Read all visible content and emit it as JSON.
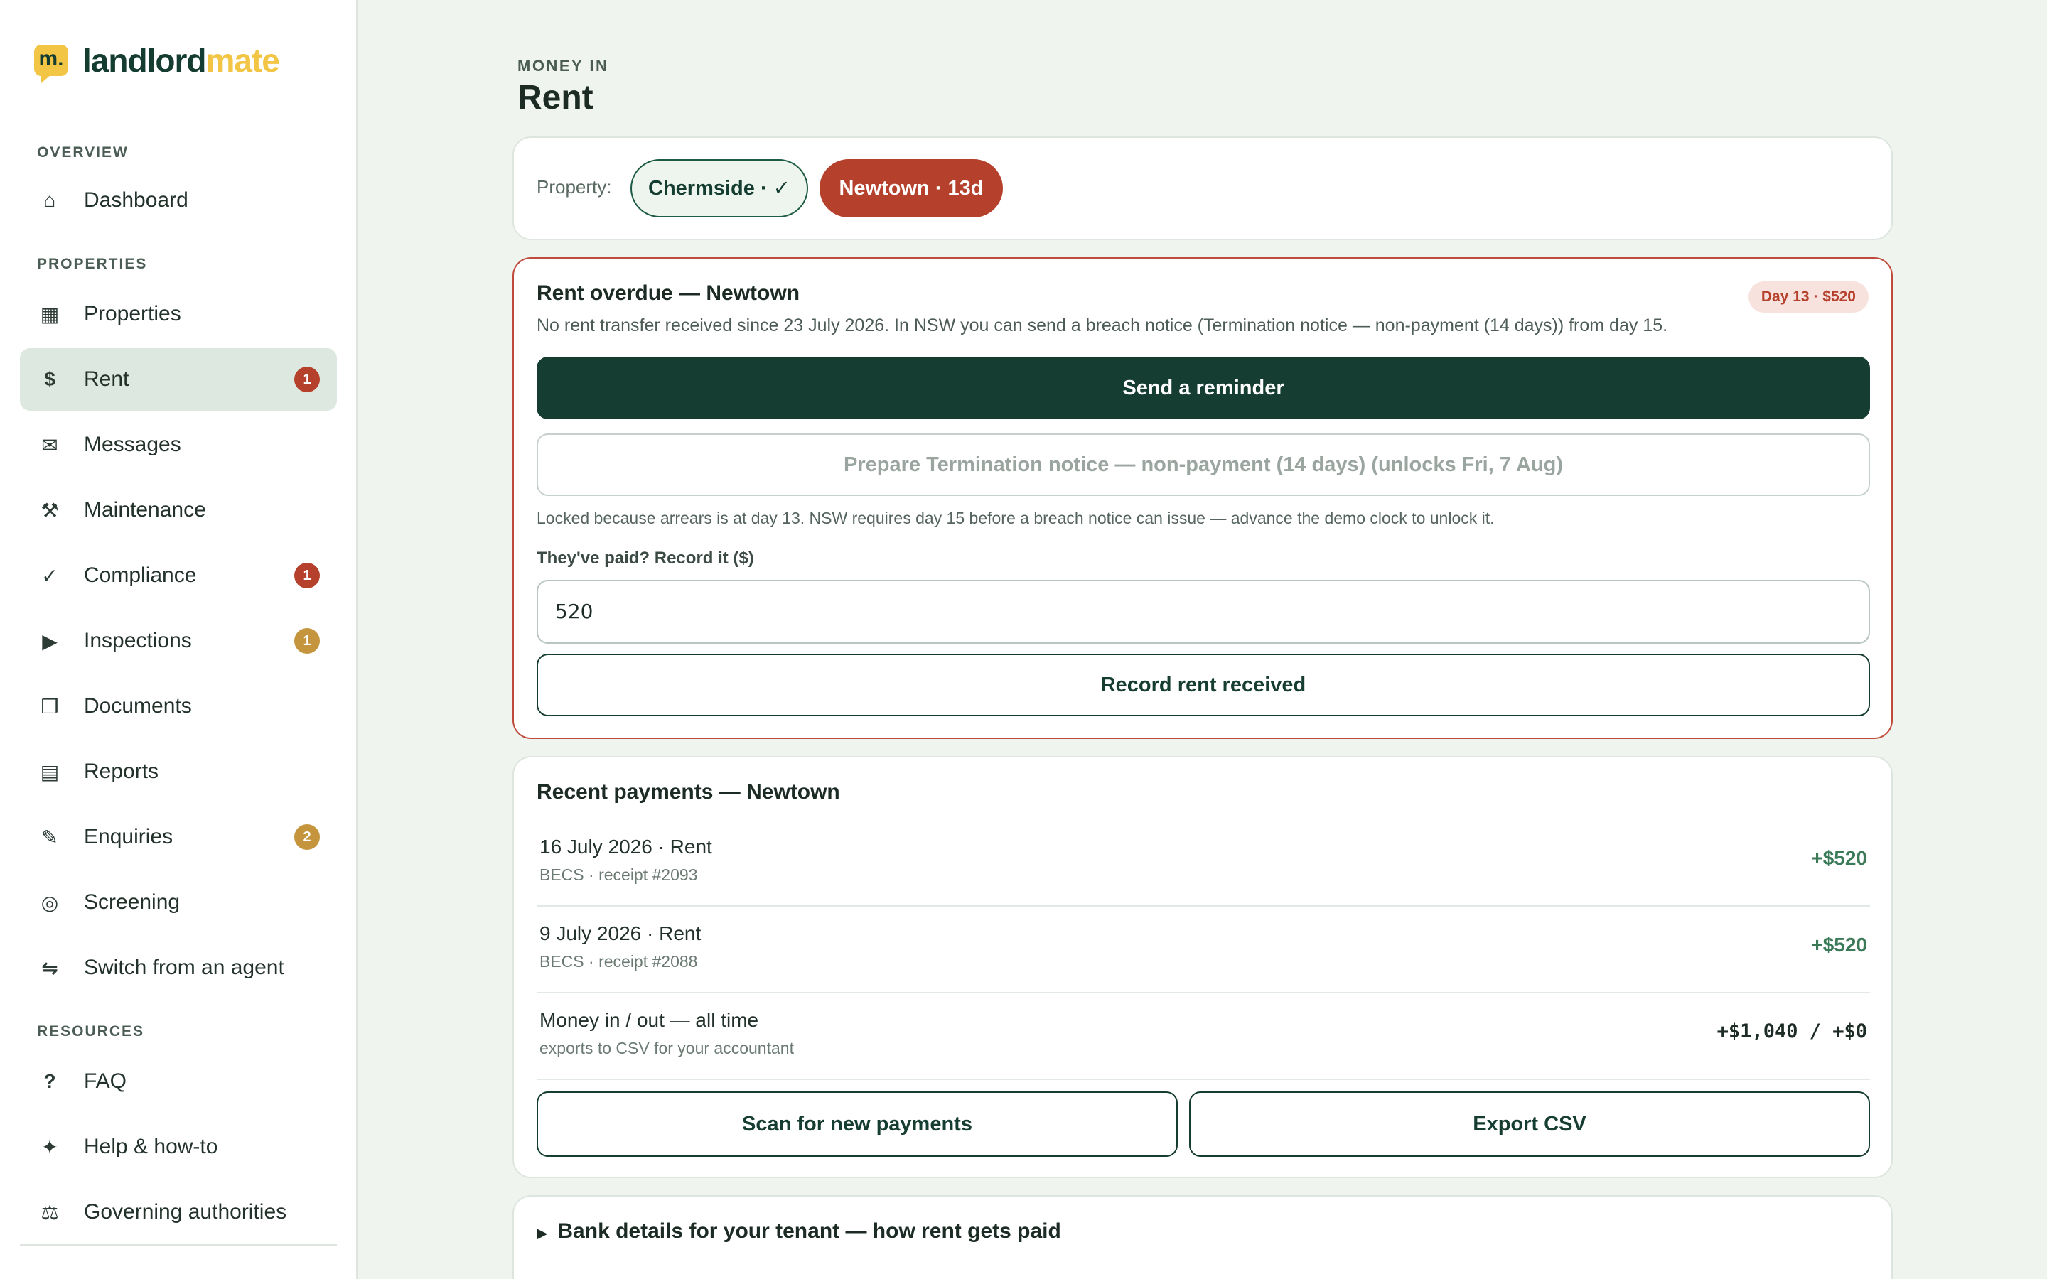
{
  "brand": {
    "mark": "m.",
    "name_part1": "landlord",
    "name_part2": "mate"
  },
  "sidebar": {
    "sections": {
      "overview": "OVERVIEW",
      "properties": "PROPERTIES",
      "resources": "RESOURCES"
    },
    "items": [
      {
        "label": "Dashboard",
        "icon": "home-icon",
        "glyph": "⌂"
      },
      {
        "label": "Properties",
        "icon": "building-icon",
        "glyph": "▦"
      },
      {
        "label": "Rent",
        "icon": "dollar-icon",
        "glyph": "$",
        "badge": "1",
        "active": true
      },
      {
        "label": "Messages",
        "icon": "mail-icon",
        "glyph": "✉"
      },
      {
        "label": "Maintenance",
        "icon": "tools-icon",
        "glyph": "⚒"
      },
      {
        "label": "Compliance",
        "icon": "check-icon",
        "glyph": "✓",
        "badge": "1"
      },
      {
        "label": "Inspections",
        "icon": "play-icon",
        "glyph": "▶",
        "badge": "1"
      },
      {
        "label": "Documents",
        "icon": "document-icon",
        "glyph": "❐"
      },
      {
        "label": "Reports",
        "icon": "report-icon",
        "glyph": "▤"
      },
      {
        "label": "Enquiries",
        "icon": "pencil-icon",
        "glyph": "✎",
        "badge": "2"
      },
      {
        "label": "Screening",
        "icon": "target-icon",
        "glyph": "◎"
      },
      {
        "label": "Switch from an agent",
        "icon": "switch-icon",
        "glyph": "⇋"
      },
      {
        "label": "FAQ",
        "icon": "question-icon",
        "glyph": "?"
      },
      {
        "label": "Help & how-to",
        "icon": "sparkle-icon",
        "glyph": "✦"
      },
      {
        "label": "Governing authorities",
        "icon": "scales-icon",
        "glyph": "⚖"
      }
    ]
  },
  "header": {
    "eyebrow": "MONEY IN",
    "title": "Rent"
  },
  "property_selector": {
    "label": "Property:",
    "chips": [
      {
        "label": "Chermside · ✓",
        "status": "ok"
      },
      {
        "label": "Newtown · 13d",
        "status": "overdue"
      }
    ]
  },
  "alert": {
    "title": "Rent overdue — Newtown",
    "badge": "Day 13 · $520",
    "description": "No rent transfer received since 23 July 2026. In NSW you can send a breach notice (Termination notice — non-payment (14 days)) from day 15.",
    "primary_button": "Send a reminder",
    "disabled_button": "Prepare Termination notice — non-payment (14 days) (unlocks Fri, 7 Aug)",
    "lock_note": "Locked because arrears is at day 13. NSW requires day 15 before a breach notice can issue — advance the demo clock to unlock it.",
    "field_label": "They've paid? Record it ($)",
    "field_value": "520",
    "record_button": "Record rent received"
  },
  "payments": {
    "title": "Recent payments — Newtown",
    "rows": [
      {
        "main": "16 July 2026 · Rent",
        "sub": "BECS · receipt #2093",
        "amount": "+$520"
      },
      {
        "main": "9 July 2026 · Rent",
        "sub": "BECS · receipt #2088",
        "amount": "+$520"
      },
      {
        "main": "Money in / out — all time",
        "sub": "exports to CSV for your accountant",
        "amount": "+$1,040 / +$0"
      }
    ],
    "scan_button": "Scan for new payments",
    "export_button": "Export CSV"
  },
  "bank": {
    "toggle": "▶",
    "label": "Bank details for your tenant — how rent gets paid"
  },
  "colors": {
    "accent": "#163d31",
    "danger": "#b5402c",
    "warning": "#c4953d",
    "brand_yellow": "#f2c545",
    "positive": "#3b7a58"
  }
}
